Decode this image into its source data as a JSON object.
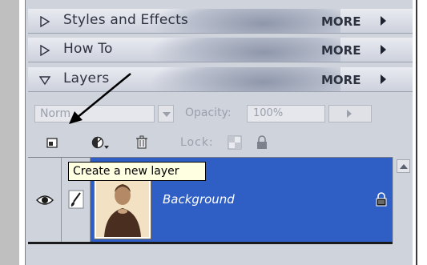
{
  "panels": [
    {
      "label": "Styles and Effects",
      "more": "MORE",
      "expanded": false
    },
    {
      "label": "How To",
      "more": "MORE",
      "expanded": false
    },
    {
      "label": "Layers",
      "more": "MORE",
      "expanded": true
    }
  ],
  "layers_options": {
    "blend_mode": "Norm",
    "opacity_label": "Opacity:",
    "opacity_value": "100%",
    "lock_label": "Lock:"
  },
  "tools": [
    "new-layer-icon",
    "adjustment-layer-icon",
    "trash-icon",
    "lock-transparency-icon",
    "lock-all-icon"
  ],
  "tooltip": "Create a new layer",
  "layer": {
    "name": "Background",
    "visible": true,
    "locked": true
  },
  "colors": {
    "selection": "#2f5fc4",
    "panel": "#cfd3dc",
    "tooltip_bg": "#ffffe1"
  }
}
